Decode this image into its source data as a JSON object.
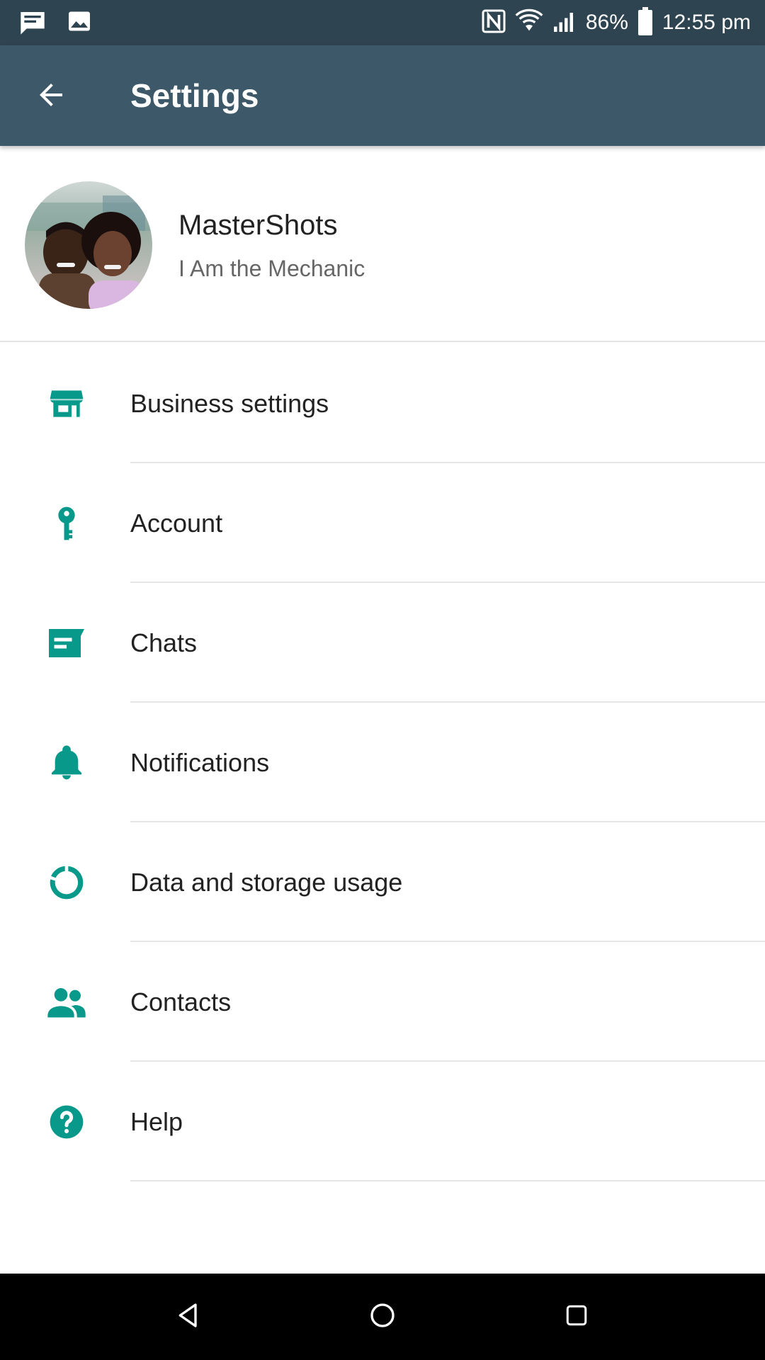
{
  "status_bar": {
    "battery_percent": "86%",
    "time": "12:55 pm",
    "icons": [
      "message-icon",
      "image-icon",
      "nfc-icon",
      "wifi-icon",
      "signal-icon",
      "battery-icon"
    ]
  },
  "toolbar": {
    "title": "Settings",
    "back_icon": "arrow-back-icon"
  },
  "profile": {
    "name": "MasterShots",
    "status": "I Am the Mechanic"
  },
  "menu": {
    "items": [
      {
        "label": "Business settings",
        "icon": "store-icon"
      },
      {
        "label": "Account",
        "icon": "key-icon"
      },
      {
        "label": "Chats",
        "icon": "chat-icon"
      },
      {
        "label": "Notifications",
        "icon": "bell-icon"
      },
      {
        "label": "Data and storage usage",
        "icon": "data-usage-icon"
      },
      {
        "label": "Contacts",
        "icon": "people-icon"
      },
      {
        "label": "Help",
        "icon": "help-icon"
      }
    ]
  },
  "nav_bar": {
    "icons": [
      "nav-back-icon",
      "nav-home-icon",
      "nav-recents-icon"
    ]
  },
  "colors": {
    "status_bar": "#2f4451",
    "toolbar": "#3d5868",
    "accent": "#08998a",
    "nav_bar": "#000000"
  }
}
